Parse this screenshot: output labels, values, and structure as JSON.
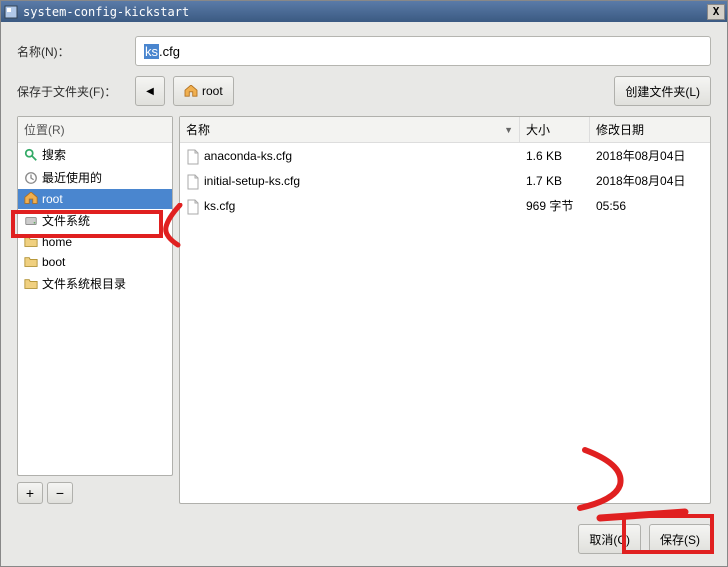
{
  "titlebar": {
    "title": "system-config-kickstart",
    "close": "X"
  },
  "labels": {
    "name": "名称(N)：",
    "save_in": "保存于文件夹(F)：",
    "create_folder": "创建文件夹(L)"
  },
  "filename": {
    "selected_part": "ks",
    "rest": ".cfg"
  },
  "path_button": {
    "label": "root"
  },
  "sidebar": {
    "header": "位置(R)",
    "items": [
      {
        "label": "搜索",
        "icon": "search"
      },
      {
        "label": "最近使用的",
        "icon": "recent"
      },
      {
        "label": "root",
        "icon": "home",
        "selected": true
      },
      {
        "label": "文件系统",
        "icon": "disk"
      },
      {
        "label": "home",
        "icon": "folder"
      },
      {
        "label": "boot",
        "icon": "folder"
      },
      {
        "label": "文件系统根目录",
        "icon": "folder"
      }
    ],
    "add": "+",
    "remove": "−"
  },
  "columns": {
    "name": "名称",
    "size": "大小",
    "date": "修改日期"
  },
  "files": [
    {
      "name": "anaconda-ks.cfg",
      "size": "1.6 KB",
      "date": "2018年08月04日"
    },
    {
      "name": "initial-setup-ks.cfg",
      "size": "1.7 KB",
      "date": "2018年08月04日"
    },
    {
      "name": "ks.cfg",
      "size": "969 字节",
      "date": "05:56"
    }
  ],
  "buttons": {
    "cancel": "取消(C)",
    "save": "保存(S)"
  }
}
